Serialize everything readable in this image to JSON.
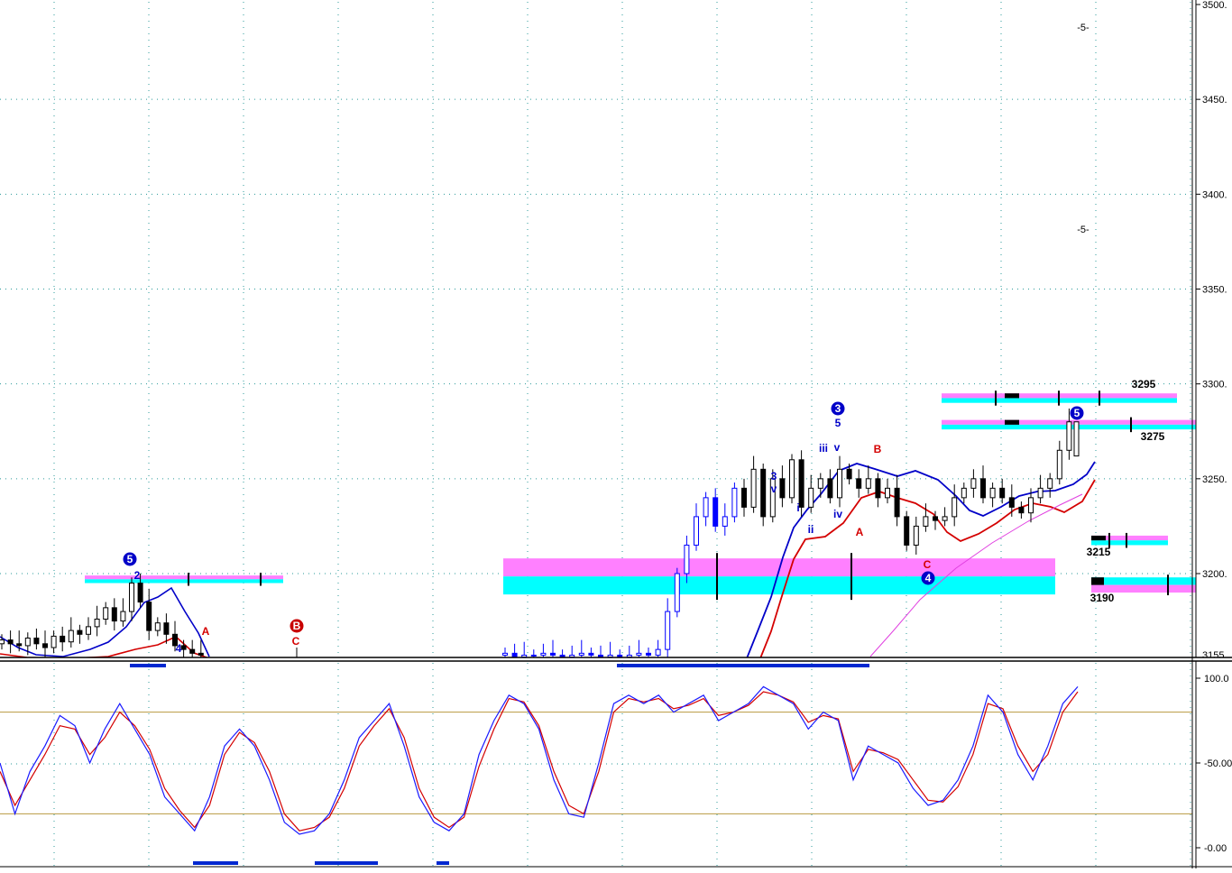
{
  "colors": {
    "background": "#ffffff",
    "grid": "#2a9a9a",
    "candle_up": "#ffffff",
    "candle_down": "#000000",
    "price_bar": "#0000ff",
    "envelope_blue": "#0000c8",
    "envelope_red": "#d40000",
    "moving_average": "#e040e0",
    "zone_magenta": "#ff80ff",
    "zone_cyan": "#00ffff",
    "stoch_k": "#1a1aff",
    "stoch_d": "#d40000",
    "stoch_level": "#b89a40",
    "label_blue": "#0000c8",
    "label_red": "#d40000",
    "circle_blue": "#0000c8",
    "circle_red": "#c80000",
    "bottom_marker": "#0028d0"
  },
  "chart_data": [
    {
      "type": "candlestick",
      "title": "",
      "xlabel": "",
      "ylabel": "",
      "ylim": [
        3155,
        3500
      ],
      "grid": true,
      "y_tick_labels": [
        "3500.",
        "3450.",
        "3400.",
        "3350.",
        "3300.",
        "3250.",
        "3200.",
        "3155"
      ],
      "level_labels": [
        "3295",
        "3275",
        "3215",
        "3190"
      ],
      "projection_labels": [
        "-5-",
        "-5-"
      ],
      "wave_labels_blue": [
        "2",
        "4",
        "3",
        "v",
        "i",
        "ii",
        "5",
        "iii",
        "v",
        "iv"
      ],
      "wave_labels_red": [
        "A",
        "C",
        "A",
        "B",
        "C"
      ],
      "circled_wave_labels": [
        {
          "text": "5",
          "color": "blue"
        },
        {
          "text": "B",
          "color": "red"
        },
        {
          "text": "3",
          "color": "blue"
        },
        {
          "text": "4",
          "color": "blue"
        },
        {
          "text": "5",
          "color": "blue"
        }
      ],
      "zones": [
        {
          "from": 3195,
          "to": 3199
        },
        {
          "from": 3189,
          "to": 3208
        },
        {
          "from": 3290,
          "to": 3295
        },
        {
          "from": 3276,
          "to": 3281
        },
        {
          "from": 3215,
          "to": 3220
        },
        {
          "from": 3190,
          "to": 3198
        }
      ],
      "closes": [
        3165,
        3163,
        3162,
        3166,
        3163,
        3161,
        3167,
        3164,
        3170,
        3168,
        3172,
        3176,
        3182,
        3175,
        3180,
        3195,
        3185,
        3170,
        3174,
        3168,
        3162,
        3160,
        3158,
        3157,
        3158,
        3156,
        3157,
        3157,
        3158,
        3157,
        3156,
        3157,
        3158,
        3157,
        3156,
        3157,
        3156,
        3157,
        3158,
        3157,
        3160,
        3180,
        3200,
        3215,
        3230,
        3240,
        3225,
        3230,
        3245,
        3235,
        3255,
        3230,
        3250,
        3240,
        3260,
        3235,
        3245,
        3250,
        3240,
        3255,
        3250,
        3245,
        3250,
        3240,
        3245,
        3230,
        3215,
        3225,
        3230,
        3228,
        3230,
        3240,
        3245,
        3250,
        3240,
        3245,
        3240,
        3235,
        3232,
        3240,
        3245,
        3250,
        3265,
        3280
      ]
    },
    {
      "type": "line",
      "title": "",
      "xlabel": "",
      "ylabel": "",
      "ylim": [
        0,
        100
      ],
      "y_tick_labels": [
        "100.0",
        "-50.00",
        "-0.00"
      ],
      "levels": [
        80,
        20
      ],
      "series": [
        {
          "values": [
            50,
            20,
            45,
            60,
            78,
            72,
            50,
            70,
            85,
            70,
            55,
            30,
            20,
            10,
            30,
            60,
            70,
            60,
            40,
            15,
            8,
            10,
            20,
            40,
            65,
            75,
            85,
            60,
            30,
            15,
            10,
            20,
            55,
            75,
            90,
            85,
            70,
            40,
            20,
            18,
            50,
            85,
            90,
            85,
            90,
            80,
            85,
            90,
            75,
            80,
            85,
            95,
            90,
            85,
            70,
            80,
            75,
            40,
            60,
            55,
            50,
            35,
            25,
            28,
            40,
            60,
            90,
            80,
            55,
            40,
            60,
            85,
            95
          ]
        },
        {
          "values": [
            45,
            25,
            40,
            55,
            72,
            70,
            55,
            65,
            80,
            72,
            58,
            35,
            22,
            12,
            25,
            55,
            68,
            62,
            45,
            20,
            10,
            12,
            18,
            35,
            60,
            72,
            82,
            65,
            35,
            18,
            12,
            18,
            48,
            70,
            88,
            86,
            72,
            45,
            25,
            20,
            45,
            80,
            88,
            86,
            88,
            82,
            84,
            88,
            78,
            80,
            84,
            92,
            90,
            86,
            74,
            78,
            76,
            45,
            58,
            56,
            52,
            40,
            28,
            27,
            36,
            55,
            85,
            82,
            60,
            45,
            55,
            80,
            92
          ]
        }
      ]
    }
  ]
}
